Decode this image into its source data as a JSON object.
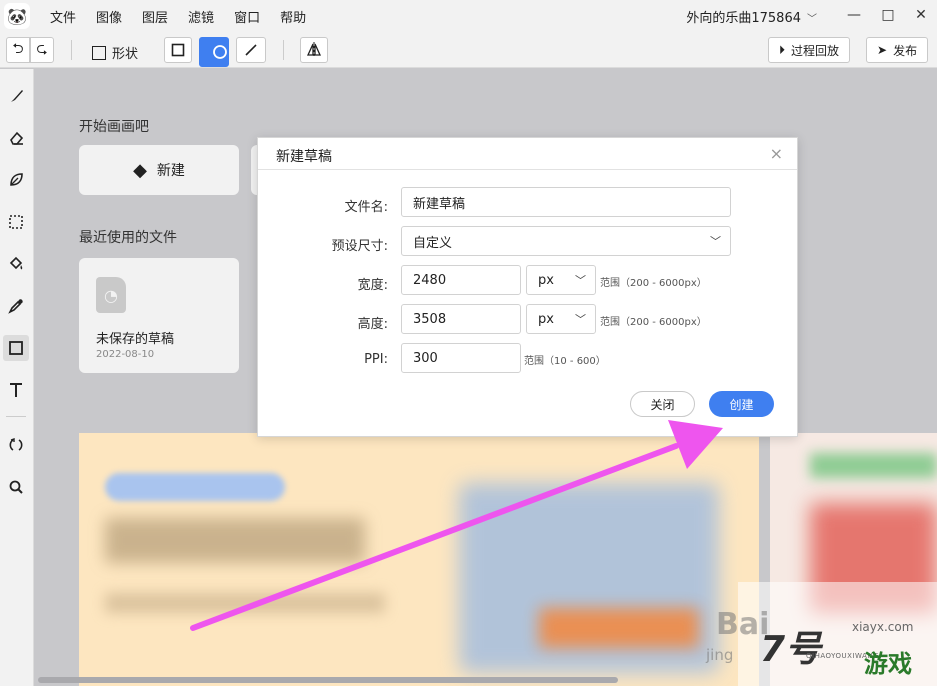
{
  "menu": {
    "items": [
      "文件",
      "图像",
      "图层",
      "滤镜",
      "窗口",
      "帮助"
    ]
  },
  "user": {
    "name": "外向的乐曲175864"
  },
  "window_controls": {
    "minimize": "—",
    "maximize": "□",
    "close": "✕"
  },
  "toolbar": {
    "shape_label": "形状",
    "history_label": "过程回放",
    "publish_label": "发布",
    "accent_color": "#3f7ff0"
  },
  "tools": [
    "brush-icon",
    "eraser-icon",
    "leaf-icon",
    "marquee-icon",
    "bucket-icon",
    "eyedropper-icon",
    "shape-icon",
    "text-icon",
    "rotate-icon",
    "zoom-icon"
  ],
  "home": {
    "start_title": "开始画画吧",
    "new_label": "新建",
    "recent_title": "最近使用的文件",
    "recent_file": {
      "name": "未保存的草稿",
      "date": "2022-08-10"
    }
  },
  "dialog": {
    "title": "新建草稿",
    "filename_label": "文件名:",
    "filename_value": "新建草稿",
    "preset_label": "预设尺寸:",
    "preset_value": "自定义",
    "width_label": "宽度:",
    "width_value": "2480",
    "width_unit": "px",
    "width_hint": "范围（200 - 6000px）",
    "height_label": "高度:",
    "height_value": "3508",
    "height_unit": "px",
    "height_hint": "范围（200 - 6000px）",
    "ppi_label": "PPI:",
    "ppi_value": "300",
    "ppi_hint": "范围（10 - 600）",
    "close_label": "关闭",
    "create_label": "创建"
  },
  "watermark": {
    "baidu": "Bai",
    "jing": "jing",
    "site": "xiayx.com",
    "number": "7号",
    "game": "游戏",
    "pinyin": "QIHAOYOUXIWANG"
  }
}
